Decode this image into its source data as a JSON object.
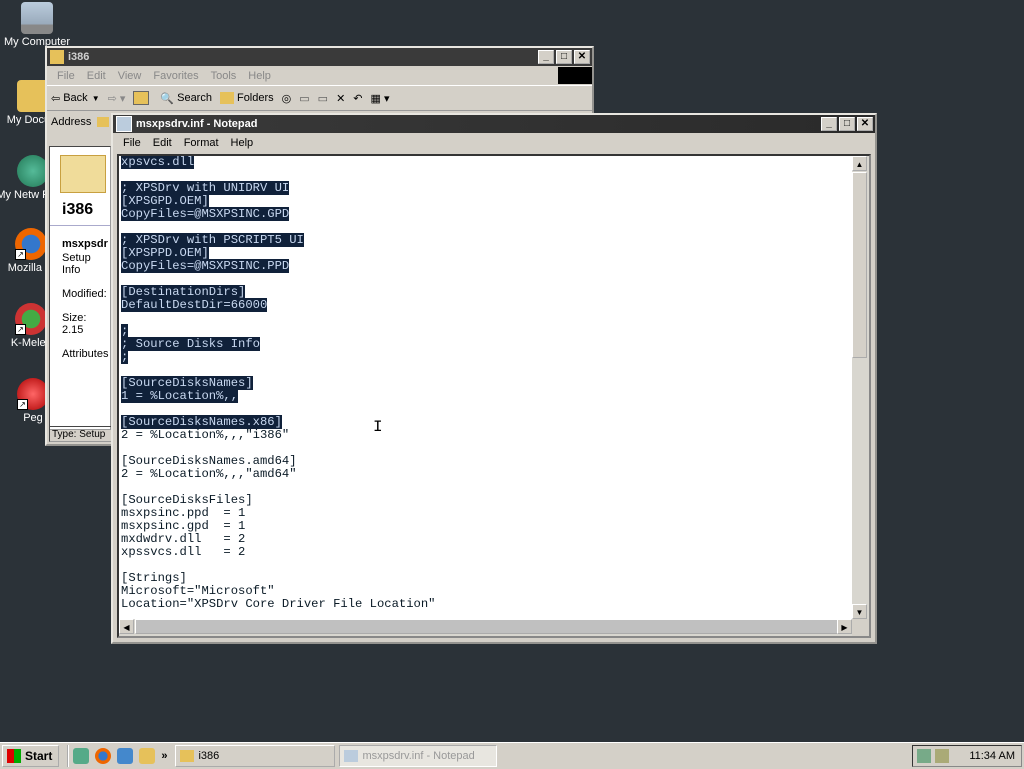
{
  "desktop": {
    "icons": [
      {
        "label": "My Computer",
        "icon": "my-computer-icon"
      },
      {
        "label": "My Docum",
        "icon": "my-documents-icon"
      },
      {
        "label": "My Netw Place",
        "icon": "network-places-icon"
      },
      {
        "label": "Mozilla Fi",
        "icon": "firefox-icon"
      },
      {
        "label": "K-Melec",
        "icon": "k-meleon-icon"
      },
      {
        "label": "Peg",
        "icon": "pegasus-icon"
      }
    ]
  },
  "explorer": {
    "title": "i386",
    "menu": [
      "File",
      "Edit",
      "View",
      "Favorites",
      "Tools",
      "Help"
    ],
    "toolbar": {
      "back": "Back",
      "search": "Search",
      "folders": "Folders"
    },
    "address_label": "Address",
    "panel": {
      "folder_title": "i386",
      "file_name": "msxpsdr",
      "file_type": "Setup Info",
      "modified": "Modified: ",
      "size": "Size: 2.15",
      "attributes": "Attributes"
    },
    "status": "Type: Setup"
  },
  "notepad": {
    "title": "msxpsdrv.inf - Notepad",
    "menu": [
      "File",
      "Edit",
      "Format",
      "Help"
    ],
    "lines": [
      {
        "text": "xpsvcs.dll",
        "sel": true
      },
      {
        "text": "",
        "sel": false
      },
      {
        "text": "; XPSDrv with UNIDRV UI",
        "sel": true
      },
      {
        "text": "[XPSGPD.OEM]",
        "sel": true
      },
      {
        "text": "CopyFiles=@MSXPSINC.GPD",
        "sel": true
      },
      {
        "text": "",
        "sel": false
      },
      {
        "text": "; XPSDrv with PSCRIPT5 UI",
        "sel": true
      },
      {
        "text": "[XPSPPD.OEM]",
        "sel": true
      },
      {
        "text": "CopyFiles=@MSXPSINC.PPD",
        "sel": true
      },
      {
        "text": "",
        "sel": false
      },
      {
        "text": "[DestinationDirs]",
        "sel": true
      },
      {
        "text": "DefaultDestDir=66000",
        "sel": true
      },
      {
        "text": "",
        "sel": false
      },
      {
        "text": ";",
        "sel": true
      },
      {
        "text": "; Source Disks Info",
        "sel": true
      },
      {
        "text": ";",
        "sel": true
      },
      {
        "text": "",
        "sel": false
      },
      {
        "text": "[SourceDisksNames]",
        "sel": true
      },
      {
        "text": "1 = %Location%,,",
        "sel": true
      },
      {
        "text": "",
        "sel": false
      },
      {
        "text": "[SourceDisksNames.x86]",
        "sel": true
      },
      {
        "text": "2 = %Location%,,,\"i386\"",
        "sel": false
      },
      {
        "text": "",
        "sel": false
      },
      {
        "text": "[SourceDisksNames.amd64]",
        "sel": false
      },
      {
        "text": "2 = %Location%,,,\"amd64\"",
        "sel": false
      },
      {
        "text": "",
        "sel": false
      },
      {
        "text": "[SourceDisksFiles]",
        "sel": false
      },
      {
        "text": "msxpsinc.ppd  = 1",
        "sel": false
      },
      {
        "text": "msxpsinc.gpd  = 1",
        "sel": false
      },
      {
        "text": "mxdwdrv.dll   = 2",
        "sel": false
      },
      {
        "text": "xpssvcs.dll   = 2",
        "sel": false
      },
      {
        "text": "",
        "sel": false
      },
      {
        "text": "[Strings]",
        "sel": false
      },
      {
        "text": "Microsoft=\"Microsoft\"",
        "sel": false
      },
      {
        "text": "Location=\"XPSDrv Core Driver File Location\"",
        "sel": false
      }
    ]
  },
  "taskbar": {
    "start": "Start",
    "quick_launch": [
      "show-desktop-icon",
      "firefox-icon",
      "outlook-icon",
      "explorer-icon"
    ],
    "overflow": "»",
    "tasks": [
      {
        "label": "i386",
        "active": false
      },
      {
        "label": "msxpsdrv.inf - Notepad",
        "active": true
      }
    ],
    "clock": "11:34 AM"
  }
}
